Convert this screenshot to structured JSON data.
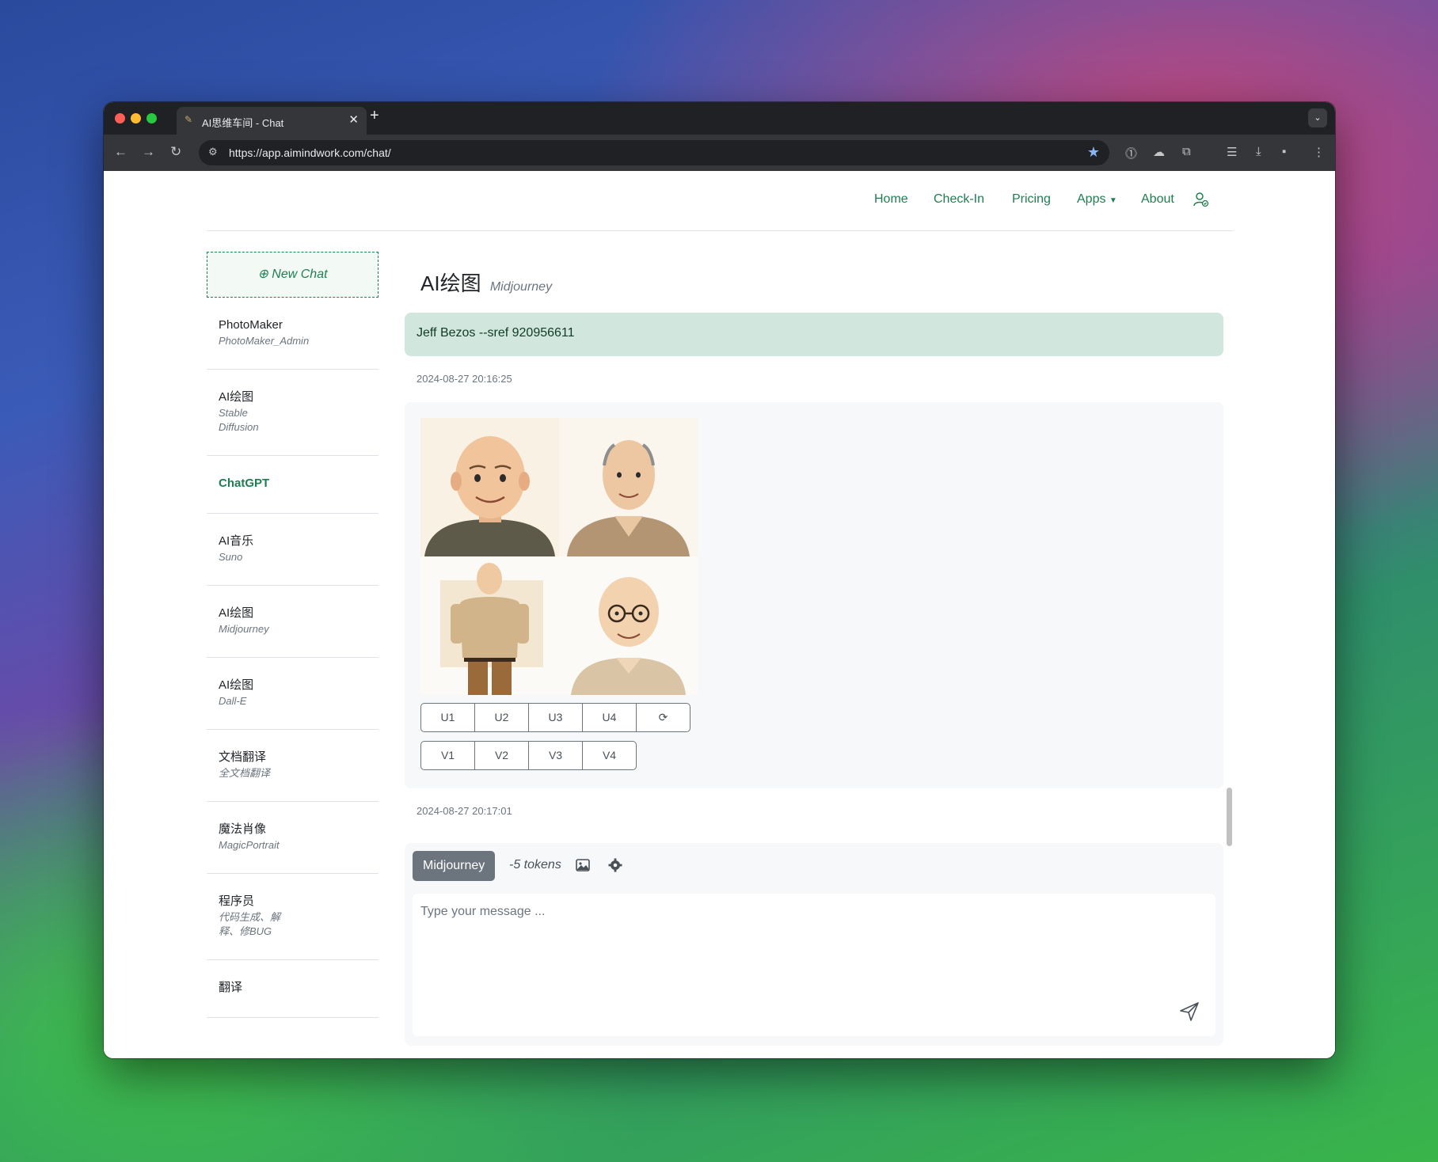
{
  "browser": {
    "tab_title": "AI思维车间 - Chat",
    "url": "https://app.aimindwork.com/chat/"
  },
  "nav": {
    "home": "Home",
    "checkin": "Check-In",
    "pricing": "Pricing",
    "apps": "Apps",
    "about": "About"
  },
  "sidebar": {
    "new_chat": "New Chat",
    "items": [
      {
        "name": "PhotoMaker",
        "sub": "PhotoMaker_Admin"
      },
      {
        "name": "AI绘图",
        "sub": "Stable\nDiffusion"
      },
      {
        "name": "ChatGPT",
        "sub": ""
      },
      {
        "name": "AI音乐",
        "sub": "Suno"
      },
      {
        "name": "AI绘图",
        "sub": "Midjourney"
      },
      {
        "name": "AI绘图",
        "sub": "Dall-E"
      },
      {
        "name": "文档翻译",
        "sub": "全文档翻译"
      },
      {
        "name": "魔法肖像",
        "sub": "MagicPortrait"
      },
      {
        "name": "程序员",
        "sub": "代码生成、解\n释、修BUG"
      },
      {
        "name": "翻译",
        "sub": ""
      }
    ]
  },
  "chat": {
    "title": "AI绘图",
    "subtitle": "Midjourney",
    "user_message": "Jeff Bezos --sref 920956611",
    "user_time": "2024-08-27 20:16:25",
    "upscale_buttons": [
      "U1",
      "U2",
      "U3",
      "U4"
    ],
    "variation_buttons": [
      "V1",
      "V2",
      "V3",
      "V4"
    ],
    "reply_time": "2024-08-27 20:17:01"
  },
  "composer": {
    "model": "Midjourney",
    "tokens": "-5 tokens",
    "placeholder": "Type your message ..."
  },
  "colors": {
    "accent": "#1e7e52",
    "user_bubble": "#d1e7dd",
    "model_button": "#6c757d"
  }
}
